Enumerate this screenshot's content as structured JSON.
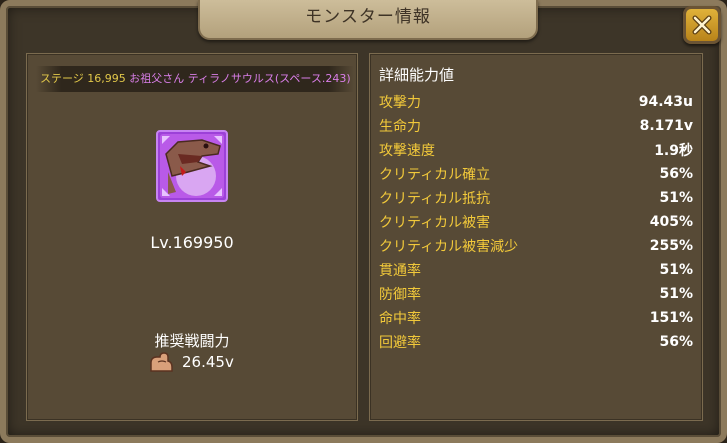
{
  "window": {
    "title": "モンスター情報"
  },
  "monster": {
    "stage_label": "ステージ 16,995",
    "name": "お祖父さん ティラノサウルス(スペース.243)",
    "level": "Lv.169950",
    "power_label": "推奨戦闘力",
    "power_value": "26.45v",
    "icon": "tyrannosaurus-portrait"
  },
  "stats": {
    "title": "詳細能力値",
    "rows": [
      {
        "label": "攻撃力",
        "value": "94.43u"
      },
      {
        "label": "生命力",
        "value": "8.171v"
      },
      {
        "label": "攻撃速度",
        "value": "1.9秒"
      },
      {
        "label": "クリティカル確立",
        "value": "56%"
      },
      {
        "label": "クリティカル抵抗",
        "value": "51%"
      },
      {
        "label": "クリティカル被害",
        "value": "405%"
      },
      {
        "label": "クリティカル被害減少",
        "value": "255%"
      },
      {
        "label": "貫通率",
        "value": "51%"
      },
      {
        "label": "防御率",
        "value": "51%"
      },
      {
        "label": "命中率",
        "value": "151%"
      },
      {
        "label": "回避率",
        "value": "56%"
      }
    ]
  },
  "colors": {
    "stat_label": "#f2c93a",
    "stage_label": "#e2c84a",
    "monster_name": "#d97ee8",
    "icon_frame": "#9c41d8"
  }
}
